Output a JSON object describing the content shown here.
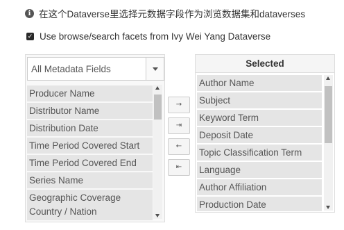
{
  "info": {
    "text": "在这个Dataverse里选择元数据字段作为浏览数据集和dataverses",
    "icon": "info-icon"
  },
  "facets_option": {
    "checked": true,
    "label": "Use browse/search facets from Ivy Wei Yang Dataverse"
  },
  "available": {
    "select_value": "All Metadata Fields",
    "items": [
      "Producer Name",
      "Distributor Name",
      "Distribution Date",
      "Time Period Covered Start",
      "Time Period Covered End",
      "Series Name",
      "Geographic Coverage Country / Nation"
    ]
  },
  "controls": {
    "add_one": "→",
    "add_all": "⇥",
    "remove_one": "←",
    "remove_all": "⇤"
  },
  "selected": {
    "header": "Selected",
    "items": [
      "Author Name",
      "Subject",
      "Keyword Term",
      "Deposit Date",
      "Topic Classification Term",
      "Language",
      "Author Affiliation",
      "Production Date"
    ]
  }
}
